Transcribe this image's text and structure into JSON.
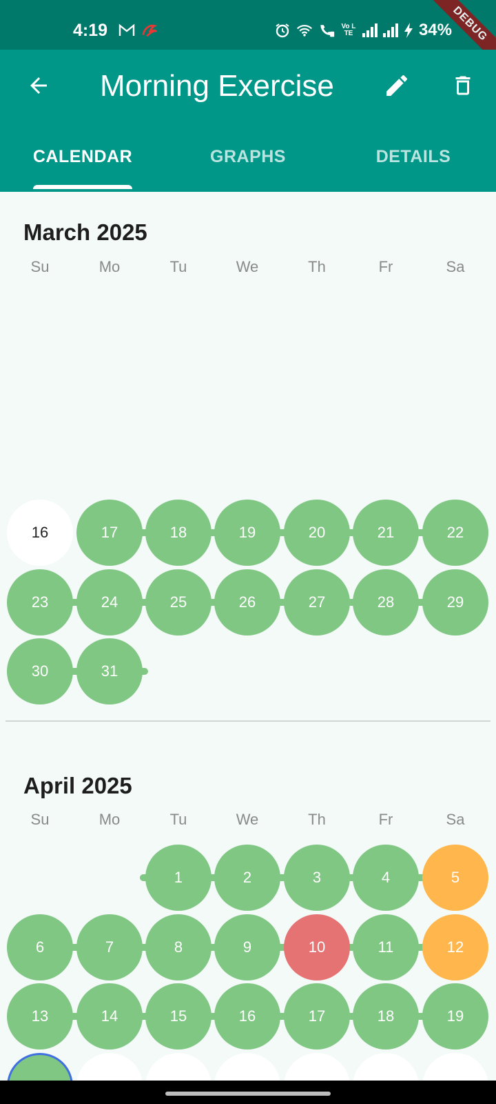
{
  "status_bar": {
    "time": "4:19",
    "left_icons": [
      "gmail-icon",
      "airtel-icon"
    ],
    "right_icons": [
      "alarm-icon",
      "wifi-icon",
      "wifi-calling-icon",
      "volte-icon",
      "signal-icon",
      "signal-icon",
      "charging-icon"
    ],
    "volte_label": "Vo LTE",
    "battery": "34%",
    "debug_banner": "DEBUG"
  },
  "app_bar": {
    "title": "Morning Exercise",
    "back_icon": "arrow-back-icon",
    "edit_icon": "pencil-icon",
    "delete_icon": "trash-icon",
    "tabs": [
      {
        "label": "CALENDAR",
        "active": true
      },
      {
        "label": "GRAPHS",
        "active": false
      },
      {
        "label": "DETAILS",
        "active": false
      }
    ]
  },
  "colors": {
    "primary": "#009688",
    "primary_dark": "#00796b",
    "done": "#81c784",
    "partial": "#ffb74d",
    "missed": "#e57373",
    "today_ring": "#3f6fe0",
    "background": "#f3faf8"
  },
  "weekdays": [
    "Su",
    "Mo",
    "Tu",
    "We",
    "Th",
    "Fr",
    "Sa"
  ],
  "months": [
    {
      "title": "March 2025",
      "weeks": [
        [
          {
            "day": "16",
            "status": "none"
          },
          {
            "day": "17",
            "status": "done"
          },
          {
            "day": "18",
            "status": "done"
          },
          {
            "day": "19",
            "status": "done"
          },
          {
            "day": "20",
            "status": "done"
          },
          {
            "day": "21",
            "status": "done"
          },
          {
            "day": "22",
            "status": "done"
          }
        ],
        [
          {
            "day": "23",
            "status": "done"
          },
          {
            "day": "24",
            "status": "done"
          },
          {
            "day": "25",
            "status": "done"
          },
          {
            "day": "26",
            "status": "done"
          },
          {
            "day": "27",
            "status": "done"
          },
          {
            "day": "28",
            "status": "done"
          },
          {
            "day": "29",
            "status": "done"
          }
        ],
        [
          {
            "day": "30",
            "status": "done"
          },
          {
            "day": "31",
            "status": "done"
          }
        ]
      ]
    },
    {
      "title": "April 2025",
      "weeks": [
        [
          {
            "day": "1",
            "status": "done"
          },
          {
            "day": "2",
            "status": "done"
          },
          {
            "day": "3",
            "status": "done"
          },
          {
            "day": "4",
            "status": "done"
          },
          {
            "day": "5",
            "status": "partial"
          }
        ],
        [
          {
            "day": "6",
            "status": "done"
          },
          {
            "day": "7",
            "status": "done"
          },
          {
            "day": "8",
            "status": "done"
          },
          {
            "day": "9",
            "status": "done"
          },
          {
            "day": "10",
            "status": "missed"
          },
          {
            "day": "11",
            "status": "done"
          },
          {
            "day": "12",
            "status": "partial"
          }
        ],
        [
          {
            "day": "13",
            "status": "done"
          },
          {
            "day": "14",
            "status": "done"
          },
          {
            "day": "15",
            "status": "done"
          },
          {
            "day": "16",
            "status": "done"
          },
          {
            "day": "17",
            "status": "done"
          },
          {
            "day": "18",
            "status": "done"
          },
          {
            "day": "19",
            "status": "done"
          }
        ]
      ]
    }
  ]
}
